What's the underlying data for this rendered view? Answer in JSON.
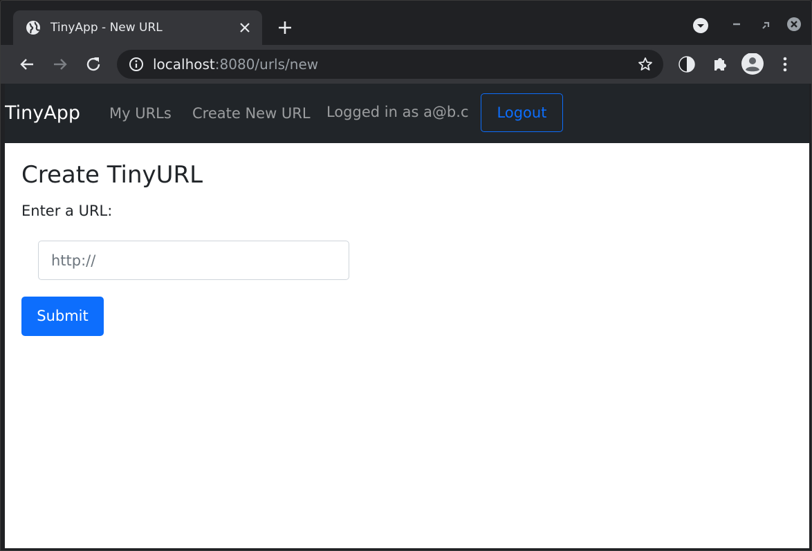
{
  "browser": {
    "tab": {
      "title": "TinyApp - New URL",
      "favicon": "globe-icon"
    },
    "address_bar": {
      "host": "localhost",
      "rest": ":8080/urls/new"
    },
    "colors": {
      "chrome_dark": "#202124",
      "chrome_toolbar": "#35363a",
      "text": "#e8eaed"
    }
  },
  "navbar": {
    "brand": "TinyApp",
    "links": [
      {
        "label": "My URLs"
      },
      {
        "label": "Create New URL"
      }
    ],
    "user_status": "Logged in as a@b.c",
    "logout_label": "Logout",
    "colors": {
      "background": "#212529",
      "primary": "#0d6efd"
    }
  },
  "main": {
    "title": "Create TinyURL",
    "form": {
      "label": "Enter a URL:",
      "input_placeholder": "http://",
      "input_value": "",
      "submit_label": "Submit"
    }
  }
}
